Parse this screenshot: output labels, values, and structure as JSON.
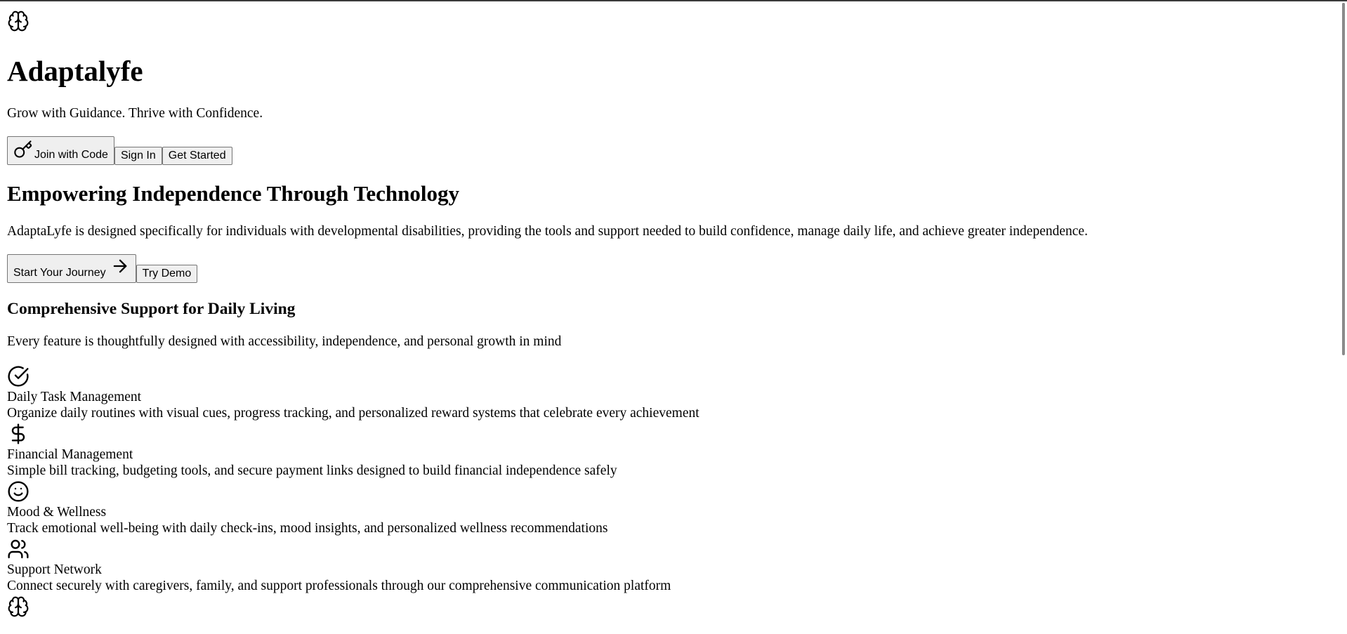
{
  "brand": {
    "icon": "brain-icon",
    "name": "Adaptalyfe",
    "tagline": "Grow with Guidance. Thrive with Confidence."
  },
  "auth_buttons": {
    "join_icon": "key-icon",
    "join_label": "Join with Code",
    "sign_in_label": "Sign In",
    "get_started_label": "Get Started"
  },
  "hero": {
    "heading": "Empowering Independence Through Technology",
    "text": "AdaptaLyfe is designed specifically for individuals with developmental disabilities, providing the tools and support needed to build confidence, manage daily life, and achieve greater independence.",
    "start_label": "Start Your Journey",
    "start_icon": "arrow-right-icon",
    "demo_label": "Try Demo"
  },
  "features": {
    "heading": "Comprehensive Support for Daily Living",
    "subheading": "Every feature is thoughtfully designed with accessibility, independence, and personal growth in mind",
    "items": [
      {
        "icon": "check-circle-icon",
        "title": "Daily Task Management",
        "description": "Organize daily routines with visual cues, progress tracking, and personalized reward systems that celebrate every achievement"
      },
      {
        "icon": "dollar-sign-icon",
        "title": "Financial Management",
        "description": "Simple bill tracking, budgeting tools, and secure payment links designed to build financial independence safely"
      },
      {
        "icon": "smile-icon",
        "title": "Mood & Wellness",
        "description": "Track emotional well-being with daily check-ins, mood insights, and personalized wellness recommendations"
      },
      {
        "icon": "users-icon",
        "title": "Support Network",
        "description": "Connect securely with caregivers, family, and support professionals through our comprehensive communication platform"
      }
    ]
  },
  "footer": {
    "icon": "brain-icon"
  },
  "colors": {
    "text": "#000000",
    "background": "#ffffff",
    "button_bg": "#efefef",
    "button_border": "#767676",
    "scrollbar_thumb": "#8a8a8a"
  }
}
